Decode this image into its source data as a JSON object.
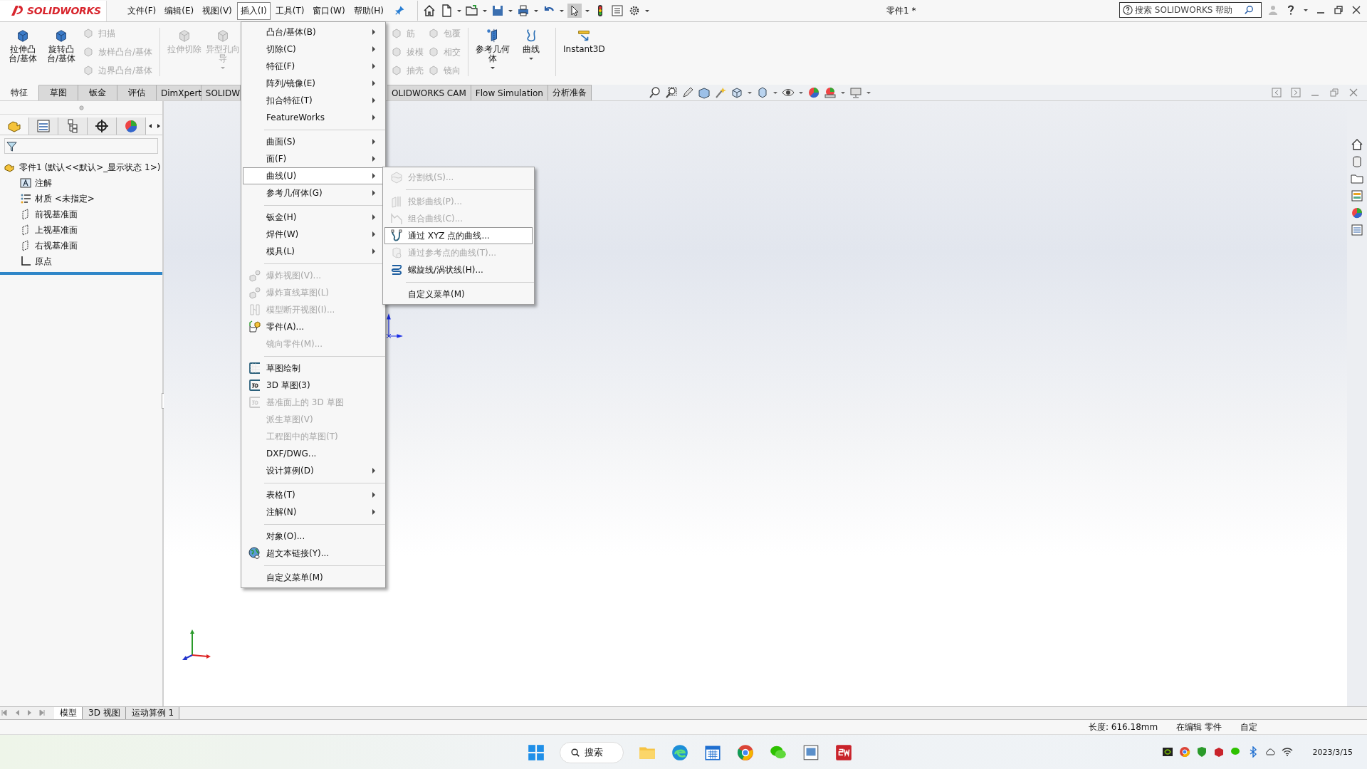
{
  "title_bar": {
    "logo": "SOLIDWORKS",
    "menus": [
      {
        "label": "文件(F)",
        "selected": false
      },
      {
        "label": "编辑(E)",
        "selected": false
      },
      {
        "label": "视图(V)",
        "selected": false
      },
      {
        "label": "插入(I)",
        "selected": true
      },
      {
        "label": "工具(T)",
        "selected": false
      },
      {
        "label": "窗口(W)",
        "selected": false
      },
      {
        "label": "帮助(H)",
        "selected": false
      }
    ],
    "document_title": "零件1 *",
    "help_search": {
      "placeholder": "搜索 SOLIDWORKS 帮助"
    }
  },
  "command_manager": {
    "left": [
      {
        "kind": "large",
        "label": "拉伸凸台/基体",
        "disabled": false,
        "dropdown": false
      },
      {
        "kind": "large",
        "label": "旋转凸台/基体",
        "disabled": false,
        "dropdown": false
      },
      {
        "kind": "column",
        "items": [
          {
            "label": "扫描",
            "disabled": true
          },
          {
            "label": "放样凸台/基体",
            "disabled": true
          },
          {
            "label": "边界凸台/基体",
            "disabled": true
          }
        ]
      },
      {
        "kind": "large",
        "label": "拉伸切除",
        "disabled": true,
        "dropdown": false
      },
      {
        "kind": "large",
        "label": "异型孔向导",
        "disabled": true,
        "dropdown": true
      }
    ],
    "right": [
      {
        "kind": "column",
        "items": [
          {
            "label": "筋",
            "disabled": true
          },
          {
            "label": "拔模",
            "disabled": true
          },
          {
            "label": "抽壳",
            "disabled": true
          }
        ]
      },
      {
        "kind": "column",
        "items": [
          {
            "label": "包覆",
            "disabled": true
          },
          {
            "label": "相交",
            "disabled": true
          },
          {
            "label": "镜向",
            "disabled": true
          }
        ]
      },
      {
        "kind": "large",
        "label": "参考几何体",
        "disabled": false,
        "dropdown": true
      },
      {
        "kind": "large",
        "label": "曲线",
        "disabled": false,
        "dropdown": true
      },
      {
        "kind": "large",
        "label": "Instant3D",
        "disabled": false,
        "dropdown": false
      }
    ]
  },
  "tabs": [
    {
      "label": "特征",
      "selected": true
    },
    {
      "label": "草图",
      "selected": false
    },
    {
      "label": "钣金",
      "selected": false
    },
    {
      "label": "评估",
      "selected": false
    },
    {
      "label": "DimXpert",
      "selected": false
    },
    {
      "label": "SOLIDW",
      "selected": false
    }
  ],
  "tabs_right": [
    {
      "label": "OLIDWORKS CAM",
      "selected": false
    },
    {
      "label": "Flow Simulation",
      "selected": false
    },
    {
      "label": "分析准备",
      "selected": false
    }
  ],
  "feature_tree": {
    "root": {
      "label": "零件1  (默认<<默认>_显示状态 1>)",
      "children": [
        {
          "label": "注解"
        },
        {
          "label": "材质 <未指定>"
        },
        {
          "label": "前视基准面"
        },
        {
          "label": "上视基准面"
        },
        {
          "label": "右视基准面"
        },
        {
          "label": "原点"
        }
      ]
    }
  },
  "insert_menu": {
    "groups": [
      [
        {
          "label": "凸台/基体(B)",
          "disabled": false,
          "submenu": true,
          "selected": false
        },
        {
          "label": "切除(C)",
          "disabled": false,
          "submenu": true,
          "selected": false
        },
        {
          "label": "特征(F)",
          "disabled": false,
          "submenu": true,
          "selected": false
        },
        {
          "label": "阵列/镜像(E)",
          "disabled": false,
          "submenu": true,
          "selected": false
        },
        {
          "label": "扣合特征(T)",
          "disabled": false,
          "submenu": true,
          "selected": false
        },
        {
          "label": "FeatureWorks",
          "disabled": false,
          "submenu": true,
          "selected": false
        }
      ],
      [
        {
          "label": "曲面(S)",
          "disabled": false,
          "submenu": true,
          "selected": false
        },
        {
          "label": "面(F)",
          "disabled": false,
          "submenu": true,
          "selected": false
        },
        {
          "label": "曲线(U)",
          "disabled": false,
          "submenu": true,
          "selected": true
        },
        {
          "label": "参考几何体(G)",
          "disabled": false,
          "submenu": true,
          "selected": false
        }
      ],
      [
        {
          "label": "钣金(H)",
          "disabled": false,
          "submenu": true,
          "selected": false
        },
        {
          "label": "焊件(W)",
          "disabled": false,
          "submenu": true,
          "selected": false
        },
        {
          "label": "模具(L)",
          "disabled": false,
          "submenu": true,
          "selected": false
        }
      ],
      [
        {
          "label": "爆炸视图(V)...",
          "disabled": true,
          "submenu": false,
          "selected": false
        },
        {
          "label": "爆炸直线草图(L)",
          "disabled": true,
          "submenu": false,
          "selected": false
        },
        {
          "label": "模型断开视图(I)...",
          "disabled": true,
          "submenu": false,
          "selected": false
        },
        {
          "label": "零件(A)...",
          "disabled": false,
          "submenu": false,
          "selected": false
        },
        {
          "label": "镜向零件(M)...",
          "disabled": true,
          "submenu": false,
          "selected": false
        }
      ],
      [
        {
          "label": "草图绘制",
          "disabled": false,
          "submenu": false,
          "selected": false
        },
        {
          "label": "3D 草图(3)",
          "disabled": false,
          "submenu": false,
          "selected": false
        },
        {
          "label": "基准面上的 3D 草图",
          "disabled": true,
          "submenu": false,
          "selected": false
        },
        {
          "label": "派生草图(V)",
          "disabled": true,
          "submenu": false,
          "selected": false
        },
        {
          "label": "工程图中的草图(T)",
          "disabled": true,
          "submenu": false,
          "selected": false
        },
        {
          "label": "DXF/DWG...",
          "disabled": false,
          "submenu": false,
          "selected": false
        },
        {
          "label": "设计算例(D)",
          "disabled": false,
          "submenu": true,
          "selected": false
        }
      ],
      [
        {
          "label": "表格(T)",
          "disabled": false,
          "submenu": true,
          "selected": false
        },
        {
          "label": "注解(N)",
          "disabled": false,
          "submenu": true,
          "selected": false
        }
      ],
      [
        {
          "label": "对象(O)...",
          "disabled": false,
          "submenu": false,
          "selected": false
        },
        {
          "label": "超文本链接(Y)...",
          "disabled": false,
          "submenu": false,
          "selected": false
        }
      ],
      [
        {
          "label": "自定义菜单(M)",
          "disabled": false,
          "submenu": false,
          "selected": false
        }
      ]
    ]
  },
  "curve_submenu": {
    "groups": [
      [
        {
          "label": "分割线(S)...",
          "disabled": true,
          "selected": false
        }
      ],
      [
        {
          "label": "投影曲线(P)...",
          "disabled": true,
          "selected": false
        },
        {
          "label": "组合曲线(C)...",
          "disabled": true,
          "selected": false
        },
        {
          "label": "通过 XYZ 点的曲线...",
          "disabled": false,
          "selected": true
        },
        {
          "label": "通过参考点的曲线(T)...",
          "disabled": true,
          "selected": false
        },
        {
          "label": "螺旋线/涡状线(H)...",
          "disabled": false,
          "selected": false
        }
      ],
      [
        {
          "label": "自定义菜单(M)",
          "disabled": false,
          "selected": false
        }
      ]
    ]
  },
  "bottom_tabs": [
    {
      "label": "模型",
      "selected": true
    },
    {
      "label": "3D 视图",
      "selected": false
    },
    {
      "label": "运动算例 1",
      "selected": false
    }
  ],
  "status_bar": {
    "length": "长度: 616.18mm",
    "mode": "在编辑 零件",
    "units": "自定"
  },
  "taskbar": {
    "search": "搜索",
    "date": "2023/3/15"
  }
}
